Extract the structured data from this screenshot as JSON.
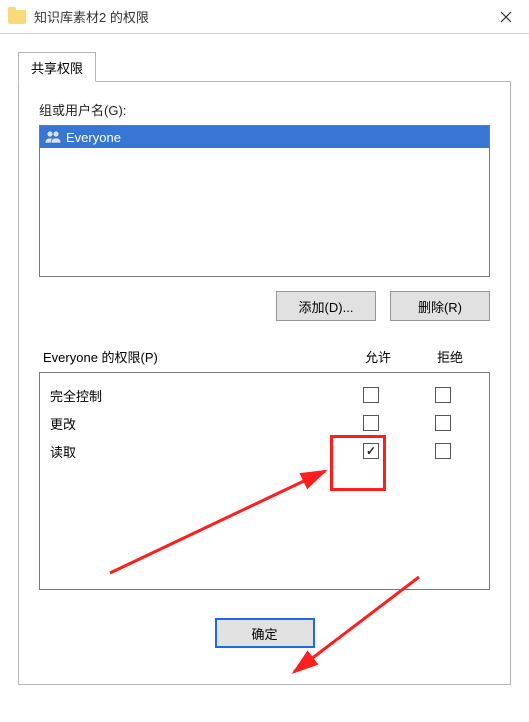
{
  "window": {
    "title": "知识库素材2 的权限"
  },
  "tab": {
    "label": "共享权限"
  },
  "groups": {
    "label": "组或用户名(G):",
    "items": [
      {
        "name": "Everyone",
        "selected": true
      }
    ]
  },
  "buttons": {
    "add": "添加(D)...",
    "remove": "删除(R)",
    "ok": "确定"
  },
  "permissions": {
    "label": "Everyone 的权限(P)",
    "col_allow": "允许",
    "col_deny": "拒绝",
    "rows": [
      {
        "name": "完全控制",
        "allow": false,
        "deny": false
      },
      {
        "name": "更改",
        "allow": false,
        "deny": false
      },
      {
        "name": "读取",
        "allow": true,
        "deny": false
      }
    ]
  }
}
